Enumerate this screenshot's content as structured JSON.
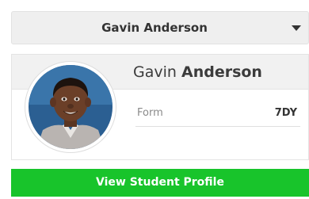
{
  "student_select": {
    "selected": "Gavin Anderson",
    "icon": "caret-down-icon"
  },
  "student_card": {
    "first_name": "Gavin",
    "last_name": "Anderson",
    "avatar_icon": "student-photo",
    "fields": [
      {
        "label": "Form",
        "value": "7DY"
      }
    ]
  },
  "actions": {
    "view_profile_label": "View Student Profile"
  },
  "colors": {
    "accent_green": "#18c42b",
    "header_grey": "#f1f1f1"
  }
}
